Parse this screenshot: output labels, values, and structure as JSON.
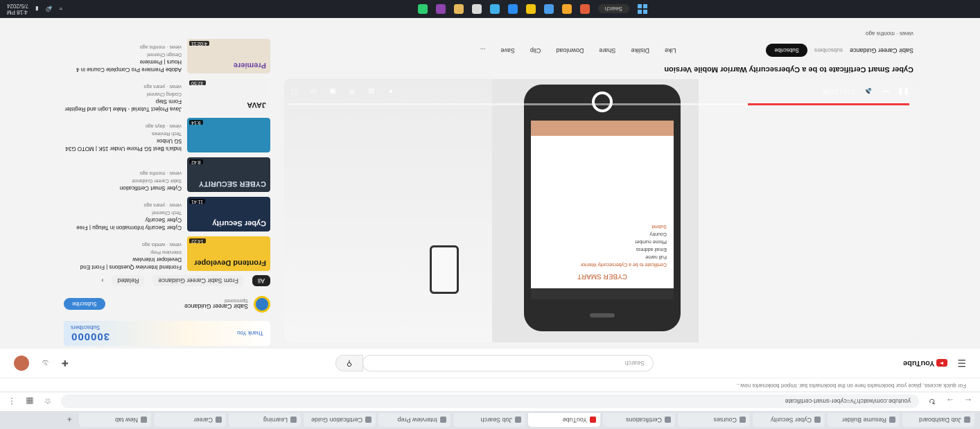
{
  "browser": {
    "tabs": [
      {
        "label": "Job Dashboard"
      },
      {
        "label": "Resume Builder"
      },
      {
        "label": "Cyber Security"
      },
      {
        "label": "Courses"
      },
      {
        "label": "Certifications"
      },
      {
        "label": "YouTube",
        "active": true
      },
      {
        "label": "Job Search"
      },
      {
        "label": "Interview Prep"
      },
      {
        "label": "Certification Guide"
      },
      {
        "label": "Learning"
      },
      {
        "label": "Career"
      },
      {
        "label": "New tab"
      }
    ],
    "new_tab": "+",
    "url": "youtube.com/watch?v=cyber-smart-certificate",
    "bookmarks_text": "For quick access, place your bookmarks here on the bookmarks bar. Import bookmarks now..."
  },
  "youtube": {
    "logo": "YouTube",
    "search_placeholder": "Search",
    "icons": [
      "create-icon",
      "bell-icon"
    ]
  },
  "video": {
    "title": "Cyber Smart Certificate to be a Cybersecurity Warrior Mobile Version",
    "channel": "Sabir Career Guidance",
    "channel_meta": "subscribers",
    "subscribe_label": "Subscribe",
    "actions": [
      "Like",
      "Dislike",
      "Share",
      "Download",
      "Clip",
      "Save",
      "..."
    ],
    "description_meta": "views · months ago",
    "progress": 0.26,
    "phone_heading": "CYBER SMART",
    "phone_lines": [
      "Certificate to be a Cybersecurity Warrior",
      "Full name",
      "Email address",
      "Phone number",
      "Country",
      "Submit"
    ],
    "time_display": "3:11 / 12:05"
  },
  "sidebar": {
    "ad": {
      "number": "300000",
      "subtitle": "Subscribers",
      "tagline": "Thank You"
    },
    "sponsor": {
      "name": "Sabir Career Guidance",
      "meta": "Sponsored",
      "button": "Subscribe"
    },
    "chips": [
      "All",
      "From Sabir Career Guidance",
      "Related"
    ],
    "recommendations": [
      {
        "title": "Frontend Interview Questions | Front End Developer Interview",
        "channel": "Interview Prep",
        "meta": "views · weeks ago",
        "thumb_title": "Frontend Developer",
        "duration": "14:22",
        "bg": "#f4c430",
        "fg": "#1a1a1a"
      },
      {
        "title": "Cyber Security Information in Telugu | Free Cyber Security",
        "channel": "Tech Channel",
        "meta": "views · years ago",
        "thumb_title": "Cyber Security",
        "duration": "11:41",
        "bg": "#1e2f4a",
        "fg": "#ffffff"
      },
      {
        "title": "Cyber Smart Certification",
        "channel": "Sabir Career Guidance",
        "meta": "views · months ago",
        "thumb_title": "CYBER SECURITY",
        "duration": "8:42",
        "bg": "#2a3340",
        "fg": "#d8e4ef"
      },
      {
        "title": "India's Best 5G Phone Under 15K | MOTO G34 5G Unbox",
        "channel": "Tech Reviews",
        "meta": "views · days ago",
        "thumb_title": "",
        "duration": "9:14",
        "bg": "#2a8ab8",
        "fg": "#ffffff"
      },
      {
        "title": "Java Project Tutorial - Make Login and Register Form Step",
        "channel": "Coding Channel",
        "meta": "views · years ago",
        "thumb_title": "JAVA",
        "duration": "32:50",
        "bg": "#f2f2f2",
        "fg": "#222222"
      },
      {
        "title": "Adobe Premiere Pro Complete Course in 4 Hours | Premiere",
        "channel": "Design Channel",
        "meta": "views · months ago",
        "thumb_title": "Premiere",
        "duration": "4:02:11",
        "bg": "#e9e0d2",
        "fg": "#6a3fa0"
      }
    ]
  },
  "taskbar": {
    "search": "Search",
    "time": "4:18 PM",
    "date": "7/5/2024",
    "tray": [
      "wifi-icon",
      "volume-icon",
      "battery-icon"
    ],
    "app_colors": [
      "#e25c3c",
      "#f4a62a",
      "#4a9be8",
      "#f1c40f",
      "#2d8cf0",
      "#3fb0e8",
      "#d9d9d9",
      "#e6b85c",
      "#8e44ad",
      "#2ecc71"
    ]
  },
  "colors": {
    "youtube_red": "#e02424",
    "progress_red": "#f03a3a",
    "subscribe_blue": "#3a86d6"
  }
}
